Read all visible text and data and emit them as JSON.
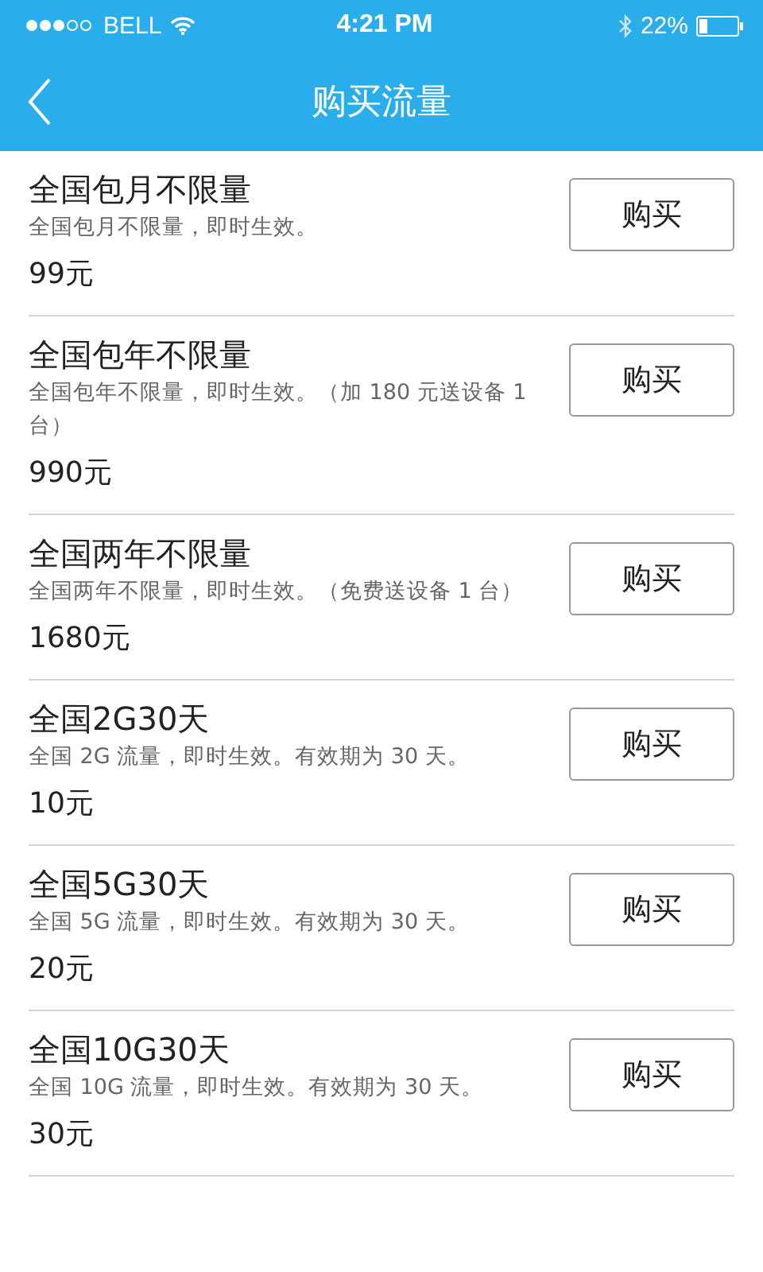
{
  "status_bar": {
    "carrier": "BELL",
    "time": "4:21 PM",
    "battery": "22%"
  },
  "nav": {
    "title": "购买流量"
  },
  "plans": [
    {
      "name": "全国包月不限量",
      "description": "全国包月不限量，即时生效。",
      "price": "99元",
      "button": "购买"
    },
    {
      "name": "全国包年不限量",
      "description": "全国包年不限量，即时生效。（加 180 元送设备 1 台）",
      "price": "990元",
      "button": "购买"
    },
    {
      "name": "全国两年不限量",
      "description": "全国两年不限量，即时生效。（免费送设备 1 台）",
      "price": "1680元",
      "button": "购买"
    },
    {
      "name": "全国2G30天",
      "description": "全国 2G 流量，即时生效。有效期为 30 天。",
      "price": "10元",
      "button": "购买"
    },
    {
      "name": "全国5G30天",
      "description": "全国 5G 流量，即时生效。有效期为 30 天。",
      "price": "20元",
      "button": "购买"
    },
    {
      "name": "全国10G30天",
      "description": "全国 10G 流量，即时生效。有效期为 30 天。",
      "price": "30元",
      "button": "购买"
    }
  ]
}
